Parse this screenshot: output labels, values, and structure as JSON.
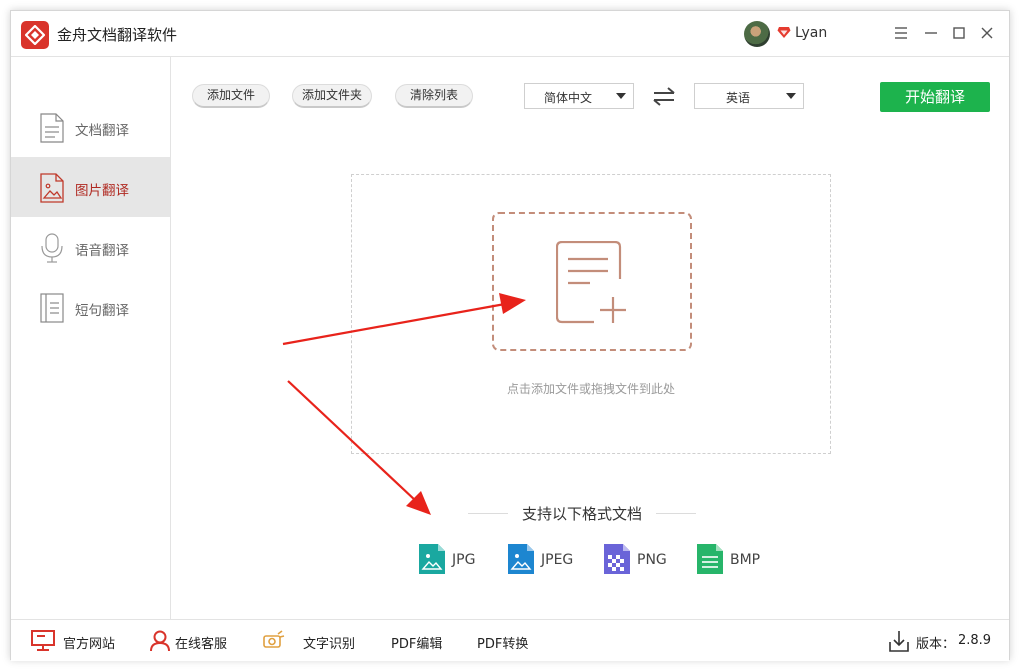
{
  "app": {
    "title": "金舟文档翻译软件",
    "username": "Lyan",
    "accent_color": "#d9342b"
  },
  "sidebar": {
    "items": [
      {
        "label": "文档翻译",
        "icon": "document-icon",
        "active": false
      },
      {
        "label": "图片翻译",
        "icon": "image-file-icon",
        "active": true
      },
      {
        "label": "语音翻译",
        "icon": "microphone-icon",
        "active": false
      },
      {
        "label": "短句翻译",
        "icon": "text-file-icon",
        "active": false
      }
    ]
  },
  "toolbar": {
    "add_file": "添加文件",
    "add_folder": "添加文件夹",
    "clear_list": "清除列表",
    "source_language": "简体中文",
    "target_language": "英语",
    "start_button": "开始翻译",
    "start_color": "#1db34d"
  },
  "dropzone": {
    "hint": "点击添加文件或拖拽文件到此处"
  },
  "formats": {
    "title": "支持以下格式文档",
    "items": [
      {
        "name": "JPG",
        "color": "#1aa8a0"
      },
      {
        "name": "JPEG",
        "color": "#1d86d0"
      },
      {
        "name": "PNG",
        "color": "#6a64d8"
      },
      {
        "name": "BMP",
        "color": "#27b56a"
      }
    ]
  },
  "footer": {
    "website": "官方网站",
    "support": "在线客服",
    "ocr": "文字识别",
    "pdf_edit": "PDF编辑",
    "pdf_convert": "PDF转换",
    "version_label": "版本：",
    "version": "2.8.9"
  }
}
